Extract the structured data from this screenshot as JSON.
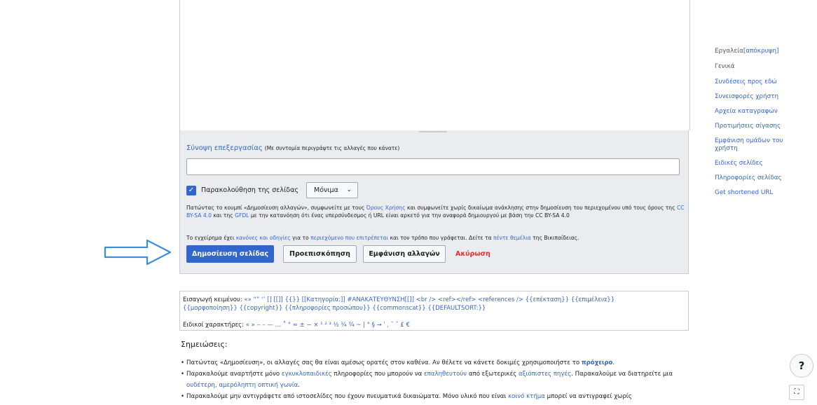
{
  "summary": {
    "label": "Σύνοψη επεξεργασίας",
    "note": "(Με συντομία περιγράψτε τις αλλαγές που κάνατε)",
    "value": ""
  },
  "watch": {
    "label": "Παρακολούθηση της σελίδας",
    "checked": true,
    "select_value": "Μόνιμα",
    "check_glyph": "✓",
    "chevron": "⌄"
  },
  "license": {
    "p1": "Πατώντας το κουμπί «Δημοσίευση αλλαγών», συμφωνείτε με τους ",
    "terms_link": "Όρους Χρήσης",
    "p2": " και συμφωνείτε χωρίς δικαίωμα ανάκλησης στην δημοσίευση του περιεχομένου υπό τους όρους της ",
    "ccbysa_link": "CC BY-SA 4.0",
    "p3": " και της ",
    "gfdl_link": "GFDL",
    "p4": " με την κατανόηση ότι ένας υπερσύνδεσμος ή URL είναι αρκετό για την αναφορά δημιουργού με βάση την CC BY-SA 4.0"
  },
  "guidelines": {
    "p1": "Το εγχείρημα έχει ",
    "rules_link": "κανόνες και οδηγίες",
    "p2": " για το ",
    "content_link": "περιεχόμενο που επιτρέπεται",
    "p3": " και τον τρόπο που γράφεται. Δείτε τα ",
    "pillars_link": "πέντε θεμέλια",
    "p4": " της Βικιπαίδειας."
  },
  "buttons": {
    "publish": "Δημοσίευση σελίδας",
    "preview": "Προεπισκόπηση",
    "changes": "Εμφάνιση αλλαγών",
    "cancel": "Ακύρωση"
  },
  "charinsert": {
    "label": "Εισαγωγή κειμένου:",
    "items1": "«» “” ‘’ [] [[]] {{}} [[Κατηγορία:]] #ΑΝΑΚΑΤΕΥΘΥΝΣΗ[[]]  <br />  <ref></ref>  <references />  {{επέκταση}}  {{επιμέλεια}}",
    "items2": "{{μορφοποίηση}}  {{copyright}}  {{πληροφορίες προσώπου}}  {{commonscat}}  {{DEFAULTSORT:}}",
    "special_label": "Ειδικοί χαρακτήρες:",
    "special_items": "« » ‒ – — … ˚ ° ≈ ± − × ¹ ² ³ ½ ¼ ¾ ~ | ° § → ˈ ˌ ˘ ˇ £ €"
  },
  "notes": {
    "heading": "Σημειώσεις:",
    "items": [
      {
        "p1": "Πατώντας «Δημοσίευση», οι αλλαγές σας θα είναι αμέσως ορατές στον καθένα. Αν θέλετε να κάνετε δοκιμές χρησιμοποιήστε το ",
        "link": "πρόχειρο",
        "p2": "."
      },
      {
        "p1": "Παρακαλούμε αναρτήστε μόνο ",
        "link1": "εγκυκλοπαιδικές",
        "p2": " πληροφορίες που μπορούν να ",
        "link2": "επαληθευτούν",
        "p3": " από εξωτερικές ",
        "link3": "αξιόπιστες πηγές",
        "p4": ". Παρακαλούμε να διατηρείτε μια ",
        "link4": "ουδέτερη, αμερόληπτη οπτική γωνία",
        "p5": "."
      },
      {
        "p1": "Παρακαλούμε μην αντιγράφετε από ιστοσελίδες που έχουν πνευματικά δικαιώματα. Μόνο υλικό που είναι ",
        "link": "κοινό κτήμα",
        "p2": " μπορεί να αντιγραφεί χωρίς"
      }
    ]
  },
  "tools": {
    "header": "Εργαλεία",
    "hide": "[απόκρυψη]",
    "general": "Γενικά",
    "items": [
      "Συνδέσεις προς εδώ",
      "Συνεισφορές χρήστη",
      "Αρχεία καταγραφών",
      "Προτιμήσεις σίγασης",
      "Εμφάνιση ομάδων του χρήστη",
      "Ειδικές σελίδες",
      "Πληροφορίες σελίδας",
      "Get shortened URL"
    ]
  },
  "help": {
    "label": "?"
  },
  "expand": {
    "label": "⛶"
  },
  "colors": {
    "link": "#3366cc",
    "cancel": "#d33333",
    "panel": "#eaecf0",
    "arrow": "#3a8fd8"
  }
}
